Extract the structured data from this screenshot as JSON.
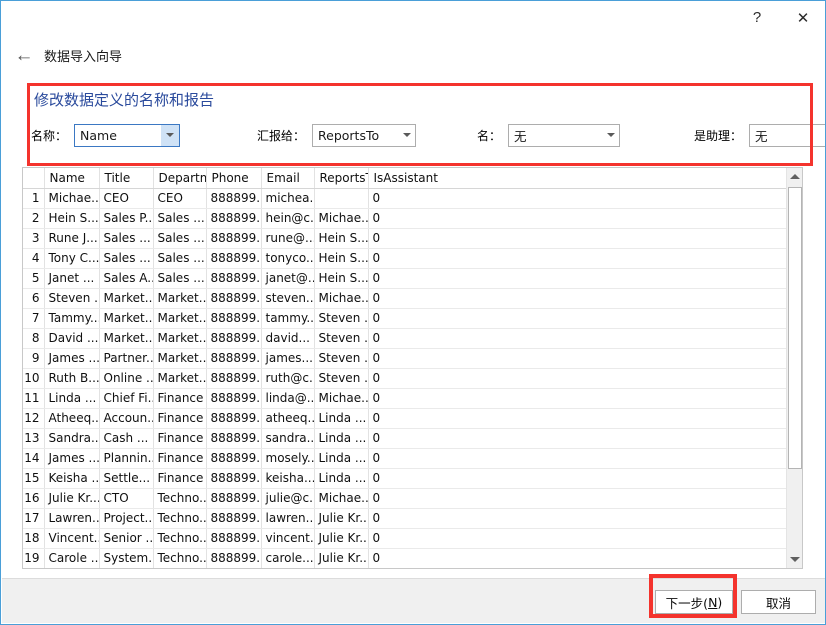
{
  "window": {
    "help_label": "?",
    "close_label": "✕",
    "back_arrow": "←",
    "wizard_title": "数据导入向导"
  },
  "panel": {
    "heading": "修改数据定义的名称和报告",
    "highlight_color": "#f4332d",
    "heading_color": "#2a4a9c",
    "fields": [
      {
        "label": "名称：",
        "value": "Name",
        "focused": true
      },
      {
        "label": "汇报给：",
        "value": "ReportsTo",
        "focused": false
      },
      {
        "label": "名：",
        "value": "无",
        "focused": false
      },
      {
        "label": "是助理：",
        "value": "无",
        "focused": false
      }
    ]
  },
  "grid": {
    "columns": [
      "",
      "Name",
      "Title",
      "Departm",
      "Phone",
      "Email",
      "ReportsT",
      "IsAssistant"
    ],
    "rows": [
      {
        "n": "1",
        "name": "Michae...",
        "title": "CEO",
        "dept": "CEO",
        "phone": "888899...",
        "email": "michea...",
        "reports": "",
        "assist": "0"
      },
      {
        "n": "2",
        "name": "Hein S...",
        "title": "Sales P...",
        "dept": "Sales ...",
        "phone": "888899...",
        "email": "hein@c...",
        "reports": "Michae...",
        "assist": "0"
      },
      {
        "n": "3",
        "name": "Rune J...",
        "title": "Sales ...",
        "dept": "Sales ...",
        "phone": "888899...",
        "email": "rune@...",
        "reports": "Hein S...",
        "assist": "0"
      },
      {
        "n": "4",
        "name": "Tony C...",
        "title": "Sales ...",
        "dept": "Sales ...",
        "phone": "888899...",
        "email": "tonyco...",
        "reports": "Hein S...",
        "assist": "0"
      },
      {
        "n": "5",
        "name": "Janet ...",
        "title": "Sales A...",
        "dept": "Sales ...",
        "phone": "888899...",
        "email": "janet@...",
        "reports": "Hein S...",
        "assist": "0"
      },
      {
        "n": "6",
        "name": "Steven ...",
        "title": "Market...",
        "dept": "Market...",
        "phone": "888899...",
        "email": "steven...",
        "reports": "Michae...",
        "assist": "0"
      },
      {
        "n": "7",
        "name": "Tammy...",
        "title": "Market...",
        "dept": "Market...",
        "phone": "888899...",
        "email": "tammy...",
        "reports": "Steven ...",
        "assist": "0"
      },
      {
        "n": "8",
        "name": "David ...",
        "title": "Market...",
        "dept": "Market...",
        "phone": "888899...",
        "email": "david...",
        "reports": "Steven ...",
        "assist": "0"
      },
      {
        "n": "9",
        "name": "James ...",
        "title": "Partner...",
        "dept": "Market...",
        "phone": "888899...",
        "email": "james...",
        "reports": "Steven ...",
        "assist": "0"
      },
      {
        "n": "10",
        "name": "Ruth B...",
        "title": "Online ...",
        "dept": "Market...",
        "phone": "888899...",
        "email": "ruth@c...",
        "reports": "Steven ...",
        "assist": "0"
      },
      {
        "n": "11",
        "name": "Linda ...",
        "title": "Chief Fi...",
        "dept": "Finance",
        "phone": "888899...",
        "email": "linda@...",
        "reports": "Michae...",
        "assist": "0"
      },
      {
        "n": "12",
        "name": "Atheeq...",
        "title": "Accoun...",
        "dept": "Finance",
        "phone": "888899...",
        "email": "atheeq...",
        "reports": "Linda ...",
        "assist": "0"
      },
      {
        "n": "13",
        "name": "Sandra...",
        "title": "Cash ...",
        "dept": "Finance",
        "phone": "888899...",
        "email": "sandra...",
        "reports": "Linda ...",
        "assist": "0"
      },
      {
        "n": "14",
        "name": "James ...",
        "title": "Plannin...",
        "dept": "Finance",
        "phone": "888899...",
        "email": "mosely...",
        "reports": "Linda ...",
        "assist": "0"
      },
      {
        "n": "15",
        "name": "Keisha ...",
        "title": "Settle...",
        "dept": "Finance",
        "phone": "888899...",
        "email": "keisha...",
        "reports": "Linda ...",
        "assist": "0"
      },
      {
        "n": "16",
        "name": "Julie Kr...",
        "title": "CTO",
        "dept": "Techno...",
        "phone": "888899...",
        "email": "julie@c...",
        "reports": "Michae...",
        "assist": "0"
      },
      {
        "n": "17",
        "name": "Lawren...",
        "title": "Project...",
        "dept": "Techno...",
        "phone": "888899...",
        "email": "lawren...",
        "reports": "Julie Kr...",
        "assist": "0"
      },
      {
        "n": "18",
        "name": "Vincent...",
        "title": "Senior ...",
        "dept": "Techno...",
        "phone": "888899...",
        "email": "vincent...",
        "reports": "Julie Kr...",
        "assist": "0"
      },
      {
        "n": "19",
        "name": "Carole ...",
        "title": "System...",
        "dept": "Techno...",
        "phone": "888899...",
        "email": "carole...",
        "reports": "Julie Kr...",
        "assist": "0"
      }
    ]
  },
  "footer": {
    "next_label_prefix": "下一步(",
    "next_accel": "N",
    "next_label_suffix": ")",
    "cancel_label": "取消",
    "highlight_color": "#f4332d"
  }
}
